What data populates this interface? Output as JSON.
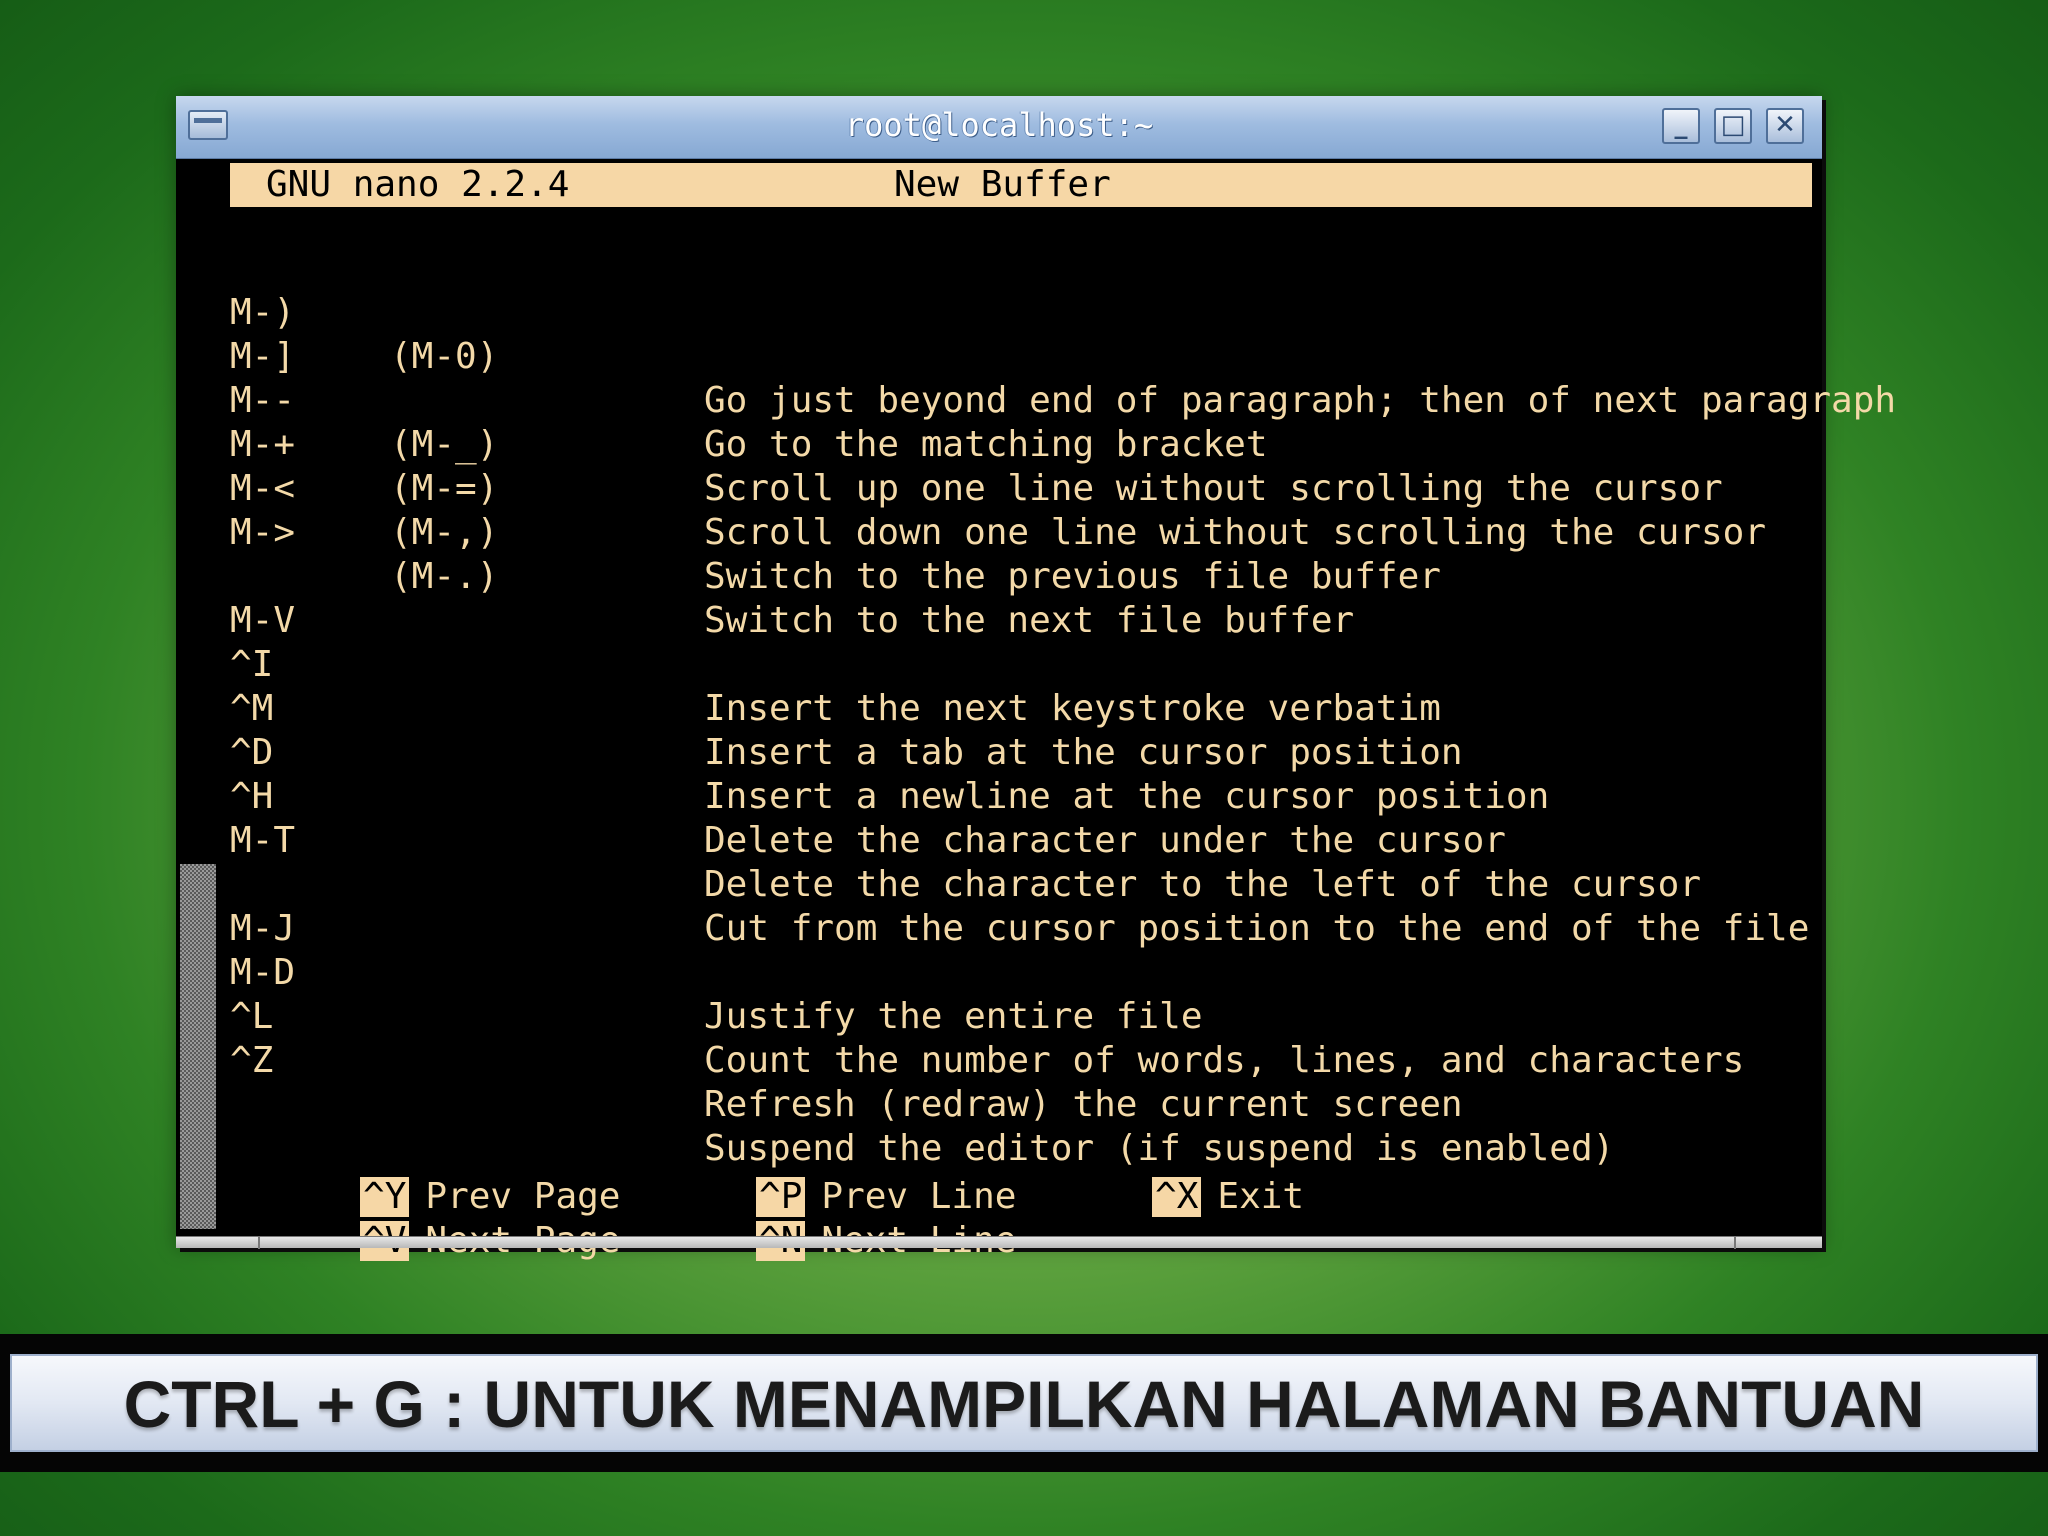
{
  "window": {
    "title": "root@localhost:~",
    "minimize_label": "_",
    "maximize_label": "□",
    "close_label": "✕"
  },
  "nano": {
    "version": "GNU nano 2.2.4",
    "buffer": "New Buffer",
    "help_rows": [
      {
        "key": "M-)",
        "alt": "(M-0)",
        "desc": "Go just beyond end of paragraph; then of next paragraph"
      },
      {
        "key": "M-]",
        "alt": "",
        "desc": "Go to the matching bracket"
      },
      {
        "key": "M--",
        "alt": "(M-_)",
        "desc": "Scroll up one line without scrolling the cursor"
      },
      {
        "key": "M-+",
        "alt": "(M-=)",
        "desc": "Scroll down one line without scrolling the cursor"
      },
      {
        "key": "M-<",
        "alt": "(M-,)",
        "desc": "Switch to the previous file buffer"
      },
      {
        "key": "M->",
        "alt": "(M-.)",
        "desc": "Switch to the next file buffer"
      },
      {
        "key": "M-V",
        "alt": "",
        "desc": "Insert the next keystroke verbatim"
      },
      {
        "key": "^I",
        "alt": "",
        "desc": "Insert a tab at the cursor position"
      },
      {
        "key": "^M",
        "alt": "",
        "desc": "Insert a newline at the cursor position"
      },
      {
        "key": "^D",
        "alt": "",
        "desc": "Delete the character under the cursor"
      },
      {
        "key": "^H",
        "alt": "",
        "desc": "Delete the character to the left of the cursor"
      },
      {
        "key": "M-T",
        "alt": "",
        "desc": "Cut from the cursor position to the end of the file"
      },
      {
        "key": "M-J",
        "alt": "",
        "desc": "Justify the entire file"
      },
      {
        "key": "M-D",
        "alt": "",
        "desc": "Count the number of words, lines, and characters"
      },
      {
        "key": "^L",
        "alt": "",
        "desc": "Refresh (redraw) the current screen"
      },
      {
        "key": "^Z",
        "alt": "",
        "desc": "Suspend the editor (if suspend is enabled)"
      }
    ],
    "shortcuts": [
      {
        "key": "^Y",
        "label": "Prev Page"
      },
      {
        "key": "^V",
        "label": "Next Page"
      },
      {
        "key": "^P",
        "label": "Prev Line"
      },
      {
        "key": "^N",
        "label": "Next Line"
      },
      {
        "key": "^X",
        "label": "Exit"
      }
    ]
  },
  "caption": "CTRL + G : UNTUK MENAMPILKAN HALAMAN BANTUAN",
  "colors": {
    "terminal_fg": "#f3d9a8",
    "terminal_bg": "#000000",
    "highlight_bg": "#f6d7a6",
    "titlebar": "#9fbce0"
  }
}
